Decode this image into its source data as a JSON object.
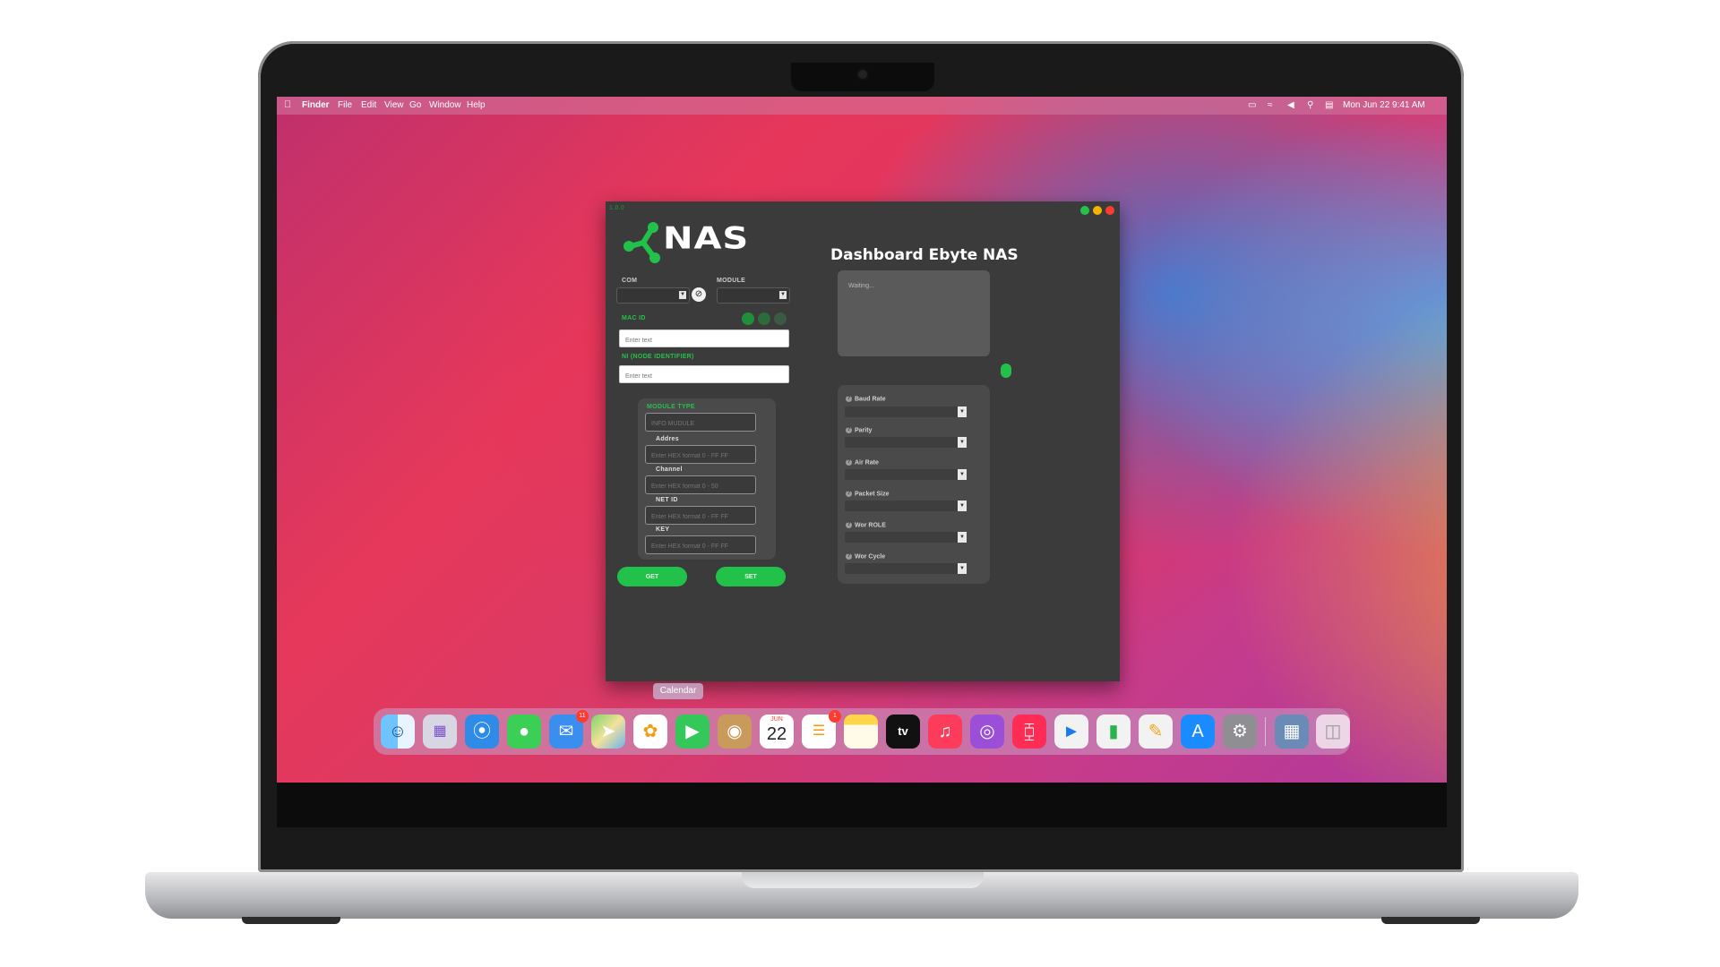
{
  "menubar": {
    "app": "Finder",
    "items": [
      "File",
      "Edit",
      "View",
      "Go",
      "Window",
      "Help"
    ],
    "clock": "Mon Jun 22  9:41 AM"
  },
  "window": {
    "version": "1.0.0",
    "logo_text": "NAS",
    "title": "Dashboard Ebyte NAS",
    "com_label": "COM",
    "module_label": "MODULE",
    "mac_id_label": "MAC ID",
    "mac_id_placeholder": "Enter text",
    "ni_label": "NI (NODE IDENTIFIER)",
    "ni_placeholder": "Enter text",
    "module_type_label": "MODULE TYPE",
    "info_module_placeholder": "INFO MUDULE",
    "address_label": "Addres",
    "address_placeholder": "Enter HEX format 0 - FF FF",
    "channel_label": "Channel",
    "channel_placeholder": "Enter HEX format 0 - 50",
    "net_id_label": "NET ID",
    "net_id_placeholder": "Enter HEX format 0 - FF FF",
    "key_label": "KEY",
    "key_placeholder": "Enter HEX format 0 - FF FF",
    "get_label": "GET",
    "set_label": "SET",
    "log_text": "Waiting...",
    "config": {
      "baud_rate": "Baud Rate",
      "parity": "Parity",
      "air_rate": "Air Rate",
      "packet_size": "Packet Size",
      "wor_role": "Wor ROLE",
      "wor_cycle": "Wor Cycle"
    }
  },
  "dock": {
    "tooltip": "Calendar",
    "calendar_month": "JUN",
    "calendar_day": "22",
    "mail_badge": "11",
    "reminders_badge": "1",
    "tv_label": "tv"
  },
  "colors": {
    "accent": "#22c24a",
    "window_bg": "#3b3b3b",
    "panel_bg": "#4a4a4a"
  }
}
